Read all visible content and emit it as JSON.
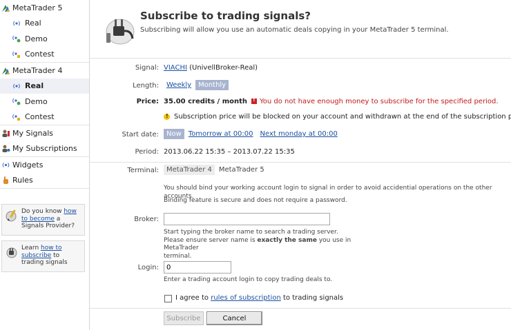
{
  "sidebar": {
    "groups": [
      {
        "label": "MetaTrader 5",
        "items": [
          "Real",
          "Demo",
          "Contest"
        ]
      },
      {
        "label": "MetaTrader 4",
        "items": [
          "Real",
          "Demo",
          "Contest"
        ]
      }
    ],
    "links": [
      "My Signals",
      "My Subscriptions"
    ],
    "links2": [
      "Widgets",
      "Rules"
    ],
    "tip1": {
      "prefix": "Do you know ",
      "link": "how to become",
      "suffix": " a Signals Provider?"
    },
    "tip2": {
      "prefix": "Learn ",
      "link": "how to subscribe",
      "suffix": " to trading signals"
    }
  },
  "header": {
    "title": "Subscribe to trading signals?",
    "subtitle": "Subscribing will allow you use an automatic deals copying in your MetaTrader 5 terminal."
  },
  "form": {
    "signal_label": "Signal:",
    "signal_link": "VIACHI",
    "signal_suffix": "(UnivellBroker-Real)",
    "length_label": "Length:",
    "length_weekly": "Weekly",
    "length_monthly": "Monthly",
    "price_label": "Price:",
    "price_value": "35.00 credits / month",
    "price_error": "You do not have enough money to subscribe for the specified period.",
    "price_warning": "Subscription price will be blocked on your account and withdrawn at the end of the subscription period.",
    "start_label": "Start date:",
    "start_now": "Now",
    "start_tomorrow": "Tomorrow at 00:00",
    "start_monday": "Next monday at 00:00",
    "period_label": "Period:",
    "period_value": "2013.06.22 15:35 – 2013.07.22 15:35",
    "terminal_label": "Terminal:",
    "terminal_mt4": "MetaTrader 4",
    "terminal_mt5": "MetaTrader 5",
    "terminal_note1": "You should bind your working account login to signal in order to avoid accidential operations on the other accounts.",
    "terminal_note2": "Binding feature is secure and does not require a password.",
    "broker_label": "Broker:",
    "broker_value": "",
    "broker_note1": "Start typing the broker name to search a trading server.",
    "broker_note2_prefix": "Please ensure server name is ",
    "broker_note2_bold": "exactly the same",
    "broker_note2_suffix": " you use in MetaTrader",
    "broker_note3": "terminal.",
    "login_label": "Login:",
    "login_value": "0",
    "login_note": "Enter a trading account login to copy trading deals to.",
    "agree_prefix": "I agree to ",
    "agree_link": "rules of subscription",
    "agree_suffix": " to trading signals",
    "subscribe_btn": "Subscribe",
    "cancel_btn": "Cancel"
  }
}
